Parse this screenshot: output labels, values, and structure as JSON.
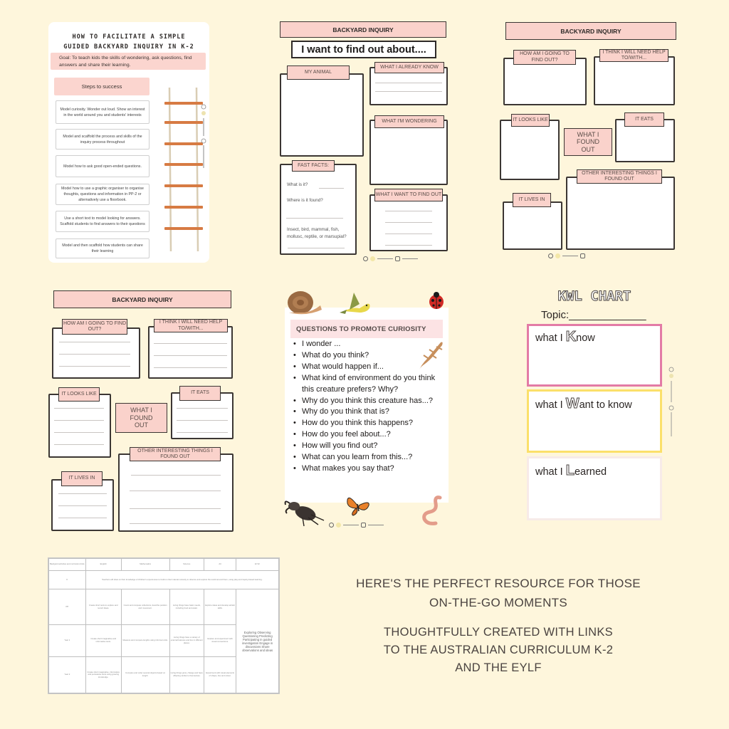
{
  "colors": {
    "background": "#fef6dc",
    "pink_label": "#fad2cb",
    "kwl_know": "#e37ba6",
    "kwl_want": "#fbe06a",
    "kwl_learned": "#f7ebe8"
  },
  "guide": {
    "title_line1": "HOW TO FACILITATE A SIMPLE",
    "title_line2": "GUIDED BACKYARD INQUIRY IN K-2",
    "goal": "Goal: To teach kids the skills of wondering, ask questions, find answers and share their learning.",
    "steps_heading": "Steps to success",
    "steps": [
      "Model curiosity. Wonder out loud. Show an interest in the world around you and students' interests",
      "Model and scaffold the process and skills of the inquiry process throughout",
      "Model how to ask good open-ended questions.",
      "Model how to use a graphic organiser to organise thoughts, questions and information in PP-2 or alternatively use a floorbook.",
      "Use a short text to model looking for answers. Scaffold students to find answers to their questions",
      "Model and then scaffold how students can share their learning"
    ],
    "ladder_icon": "rope-ladder-illustration"
  },
  "worksheet1": {
    "title": "BACKYARD INQUIRY",
    "subtitle": "I want to find out about....",
    "boxes": {
      "my_animal": "MY ANIMAL",
      "already_know": "WHAT I ALREADY KNOW",
      "wondering": "WHAT I'M WONDERING",
      "fast_facts": "FAST FACTS:",
      "want_to_find_out": "WHAT I WANT TO FIND OUT"
    },
    "fast_facts_prompts": [
      "What is it?",
      "Where is it found?",
      "Insect, bird, mammal,  fish, mollusc, reptile, or marsupial?"
    ]
  },
  "worksheet2": {
    "title": "BACKYARD INQUIRY",
    "labels": {
      "how_find_out": "HOW AM I GOING TO FIND OUT?",
      "need_help": "I THINK I WILL NEED HELP TO/WITH...",
      "looks_like": "IT LOOKS LIKE",
      "eats": "IT EATS",
      "found_out": "WHAT I FOUND OUT",
      "other_things": "OTHER INTERESTING THINGS I FOUND OUT",
      "lives_in": "IT LIVES IN"
    }
  },
  "worksheet3": {
    "title": "BACKYARD INQUIRY",
    "labels": {
      "how_find_out": "HOW AM I GOING TO FIND OUT?",
      "need_help": "I THINK I WILL NEED HELP TO/WITH...",
      "looks_like": "IT LOOKS LIKE",
      "eats": "IT EATS",
      "found_out": "WHAT I FOUND OUT",
      "other_things": "OTHER INTERESTING THINGS I FOUND OUT",
      "lives_in": "IT LIVES IN"
    }
  },
  "questions": {
    "heading": "QUESTIONS TO PROMOTE CURIOSITY",
    "items": [
      "I wonder ...",
      "What do you think?",
      "What would happen if...",
      "What kind of environment do you think this creature prefers? Why?",
      "Why do you think this creature has...?",
      "Why do you think that is?",
      "How do you think this happens?",
      "How do you feel about...?",
      "How will you find out?",
      "What can you learn from this...?",
      "What makes you say that?"
    ],
    "illustrations": [
      "snail",
      "bird",
      "ladybug",
      "gecko",
      "stag-beetle",
      "butterfly",
      "worm"
    ]
  },
  "kwl": {
    "title": "KWL CHART",
    "topic": "Topic:_____________",
    "know": {
      "pre": "what I ",
      "letter": "K",
      "post": "now"
    },
    "want": {
      "pre": "what I ",
      "letter": "W",
      "post": "ant to know"
    },
    "learned": {
      "pre": "what I ",
      "letter": "L",
      "post": "earned"
    }
  },
  "curriculum_table": {
    "headers": [
      "Backyard activities and curriculum links",
      "English",
      "Mathematics",
      "Science",
      "Art",
      "EYLF"
    ],
    "rows": [
      {
        "year": "K",
        "text": "Teachers will draw on their knowledge of children's experiences to build on their natural curiosity to observe and explore the world around them, using play and inquiry-based learning."
      },
      {
        "year": "PP",
        "english": "Create short texts to explore and record ideas.",
        "maths": "Count and compare collections; describe position and movement.",
        "science": "Living things have basic needs, including food and water.",
        "art": "Explore ideas and develop artistic skills."
      },
      {
        "year": "Year 1",
        "english": "Create short imaginative and informative texts.",
        "maths": "Measure and compare lengths using informal units.",
        "science": "Living things have a variety of external features and live in different places.",
        "art": "Explore and experiment with visual conventions."
      },
      {
        "year": "Year 2",
        "english": "Create short imaginative, informative and persuasive texts using growing knowledge.",
        "maths": "Compare and order several objects based on length.",
        "science": "Living things grow, change and have offspring similar to themselves.",
        "art": "Experiment with visual elements of shape, line and colour."
      }
    ],
    "eylf": "Exploring Observing Questioning Predicting Participating in guided investigation Engage in discussions Share observations and ideas"
  },
  "promo": {
    "line1a": "HERE'S THE PERFECT RESOURCE FOR THOSE",
    "line1b": "ON-THE-GO MOMENTS",
    "line2a": "THOUGHTFULLY CREATED WITH LINKS",
    "line2b": "TO THE AUSTRALIAN CURRICULUM K-2",
    "line2c": "AND THE EYLF"
  }
}
